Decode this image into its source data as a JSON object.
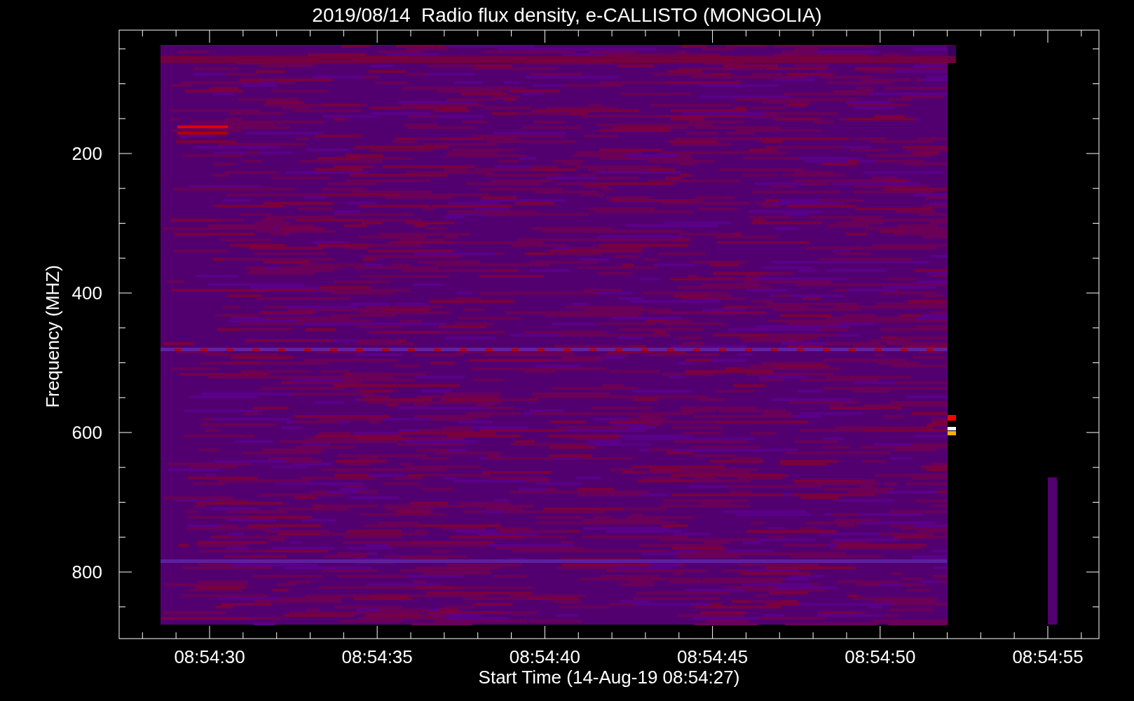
{
  "plot": {
    "title": "2019/08/14  Radio flux density, e-CALLISTO (MONGOLIA)",
    "xlabel": "Start Time (14-Aug-19 08:54:27)",
    "ylabel": "Frequency (MHZ)",
    "x_tick_labels": [
      "08:54:30",
      "08:54:35",
      "08:54:40",
      "08:54:45",
      "08:54:50",
      "08:54:55"
    ],
    "y_tick_labels": [
      "200",
      "400",
      "600",
      "800"
    ]
  }
}
